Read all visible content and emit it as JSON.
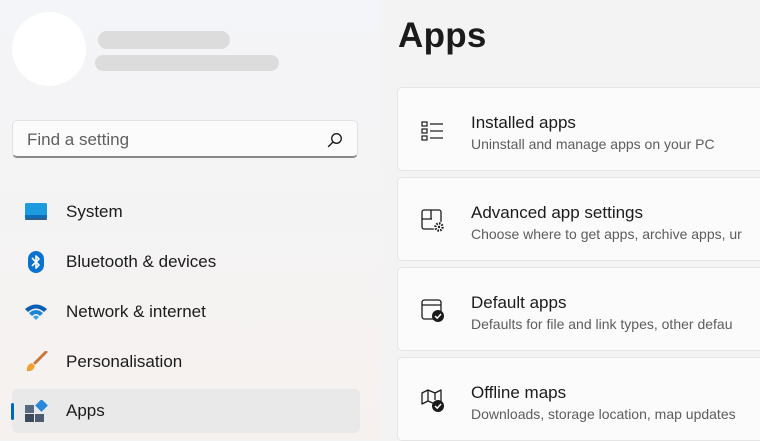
{
  "sidebar": {
    "search": {
      "placeholder": "Find a setting",
      "icon": "search-icon"
    },
    "items": [
      {
        "label": "System",
        "icon": "system-icon"
      },
      {
        "label": "Bluetooth & devices",
        "icon": "bluetooth-icon"
      },
      {
        "label": "Network & internet",
        "icon": "wifi-icon"
      },
      {
        "label": "Personalisation",
        "icon": "brush-icon"
      },
      {
        "label": "Apps",
        "icon": "apps-icon",
        "selected": true
      }
    ]
  },
  "main": {
    "title": "Apps",
    "cards": [
      {
        "title": "Installed apps",
        "subtitle": "Uninstall and manage apps on your PC",
        "icon": "list-icon"
      },
      {
        "title": "Advanced app settings",
        "subtitle": "Choose where to get apps, archive apps, ur",
        "icon": "app-settings-icon"
      },
      {
        "title": "Default apps",
        "subtitle": "Defaults for file and link types, other defau",
        "icon": "default-apps-icon"
      },
      {
        "title": "Offline maps",
        "subtitle": "Downloads, storage location, map updates",
        "icon": "map-icon"
      }
    ]
  },
  "colors": {
    "accent": "#0067c0",
    "selected_bg": "#e9e9ea",
    "card_bg": "#fbfbfb"
  }
}
